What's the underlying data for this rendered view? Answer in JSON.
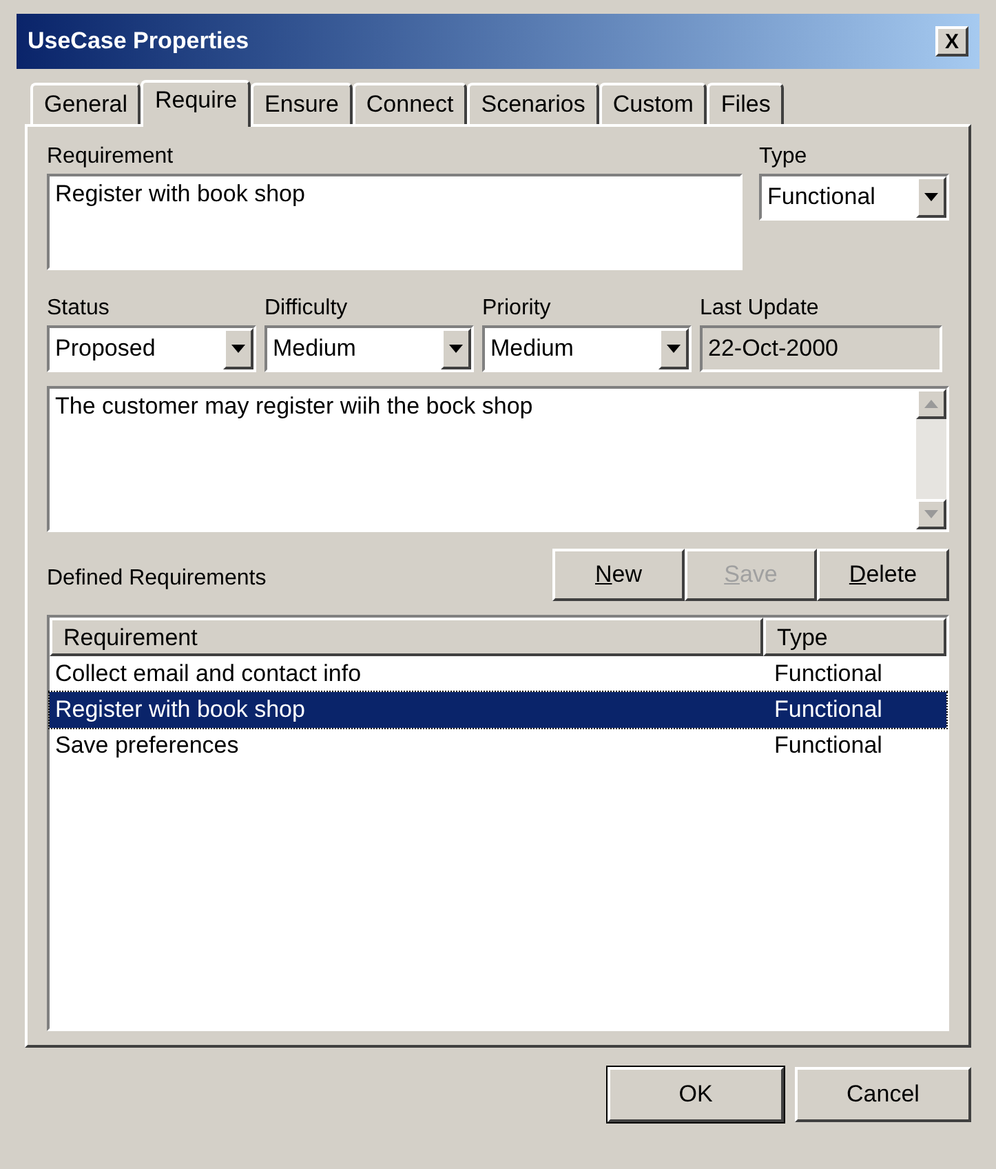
{
  "window": {
    "title": "UseCase Properties",
    "close": "X"
  },
  "tabs": [
    {
      "label": "General",
      "selected": false
    },
    {
      "label": "Require",
      "selected": true
    },
    {
      "label": "Ensure",
      "selected": false
    },
    {
      "label": "Connect",
      "selected": false
    },
    {
      "label": "Scenarios",
      "selected": false
    },
    {
      "label": "Custom",
      "selected": false
    },
    {
      "label": "Files",
      "selected": false
    }
  ],
  "requirement": {
    "label": "Requirement",
    "value": "Register with book shop"
  },
  "type": {
    "label": "Type",
    "value": "Functional"
  },
  "fields": [
    {
      "label": "Status",
      "value": "Proposed",
      "kind": "dropdown"
    },
    {
      "label": "Difficulty",
      "value": "Medium",
      "kind": "dropdown"
    },
    {
      "label": "Priority",
      "value": "Medium",
      "kind": "dropdown"
    },
    {
      "label": "Last Update",
      "value": "22-Oct-2000",
      "kind": "readonly"
    }
  ],
  "notes": "The customer may register wiih the bock shop",
  "defined_label": "Defined Requirements",
  "list_buttons": [
    {
      "label": "New",
      "disabled": false
    },
    {
      "label": "Save",
      "disabled": true
    },
    {
      "label": "Delete",
      "disabled": false
    }
  ],
  "table": {
    "columns": [
      "Requirement",
      "Type"
    ],
    "rows": [
      {
        "cells": [
          "Collect email and contact info",
          "Functional"
        ],
        "selected": false
      },
      {
        "cells": [
          "Register with book shop",
          "Functional"
        ],
        "selected": true
      },
      {
        "cells": [
          "Save preferences",
          "Functional"
        ],
        "selected": false
      }
    ]
  },
  "buttons": [
    {
      "label": "OK",
      "default": true
    },
    {
      "label": "Cancel",
      "default": false
    }
  ]
}
